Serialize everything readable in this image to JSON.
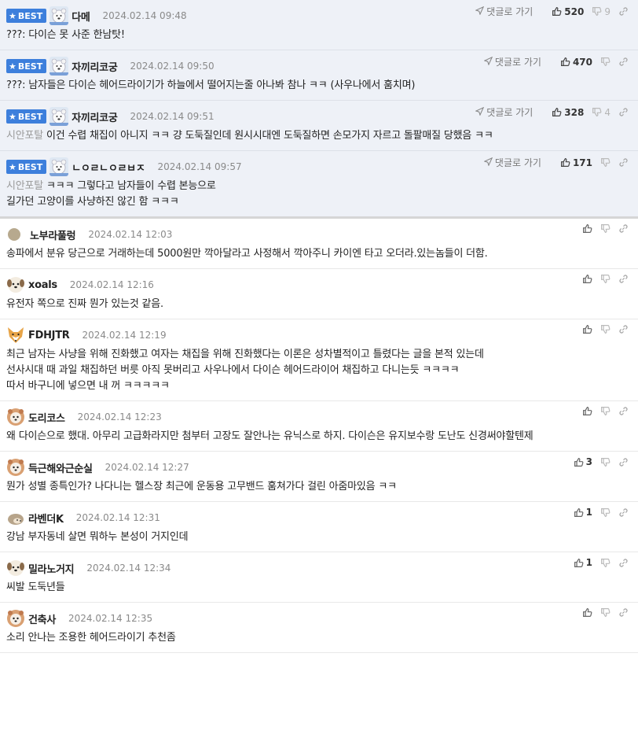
{
  "labels": {
    "best": "BEST",
    "goto_comment": "댓글로 가기"
  },
  "comments": [
    {
      "best": true,
      "avatar": "polar-bear",
      "nick": "다메",
      "date": "2024.02.14 09:48",
      "tag": "",
      "lines": [
        "???: 다이슨 못 사준 한남탓!"
      ],
      "up": "520",
      "down": "9",
      "goto": true
    },
    {
      "best": true,
      "avatar": "polar-bear",
      "nick": "자끼리코궁",
      "date": "2024.02.14 09:50",
      "tag": "",
      "lines": [
        "???: 남자들은 다이슨 헤어드라이기가 하늘에서 떨어지는줄 아나봐 참나 ㅋㅋ (사우나에서 훔치며)"
      ],
      "up": "470",
      "down": "",
      "goto": true
    },
    {
      "best": true,
      "avatar": "polar-bear",
      "nick": "자끼리코궁",
      "date": "2024.02.14 09:51",
      "tag": "시안포탈",
      "lines": [
        "이건 수렵 채집이 아니지 ㅋㅋ 걍 도둑질인데 원시시대엔 도둑질하면 손모가지 자르고 돌팔매질 당했음 ㅋㅋ"
      ],
      "up": "328",
      "down": "4",
      "goto": true
    },
    {
      "best": true,
      "avatar": "polar-bear",
      "nick": "ㄴㅇㄹㄴㅇㄹㅂㅈ",
      "date": "2024.02.14 09:57",
      "tag": "시안포탈",
      "lines": [
        "ㅋㅋㅋ 그렇다고 남자들이 수렵 본능으로",
        "길가던 고양이를 사냥하진 않긴 함 ㅋㅋㅋ"
      ],
      "up": "171",
      "down": "",
      "goto": true
    },
    {
      "best": false,
      "avatar": "dot",
      "nick": "노부라풀렁",
      "date": "2024.02.14 12:03",
      "tag": "",
      "lines": [
        "송파에서 분유 당근으로 거래하는데 5000원만 깍아달라고 사정해서 깍아주니 카이엔 타고 오더라.있는놈들이 더함."
      ],
      "up": "",
      "down": "",
      "goto": false
    },
    {
      "best": false,
      "avatar": "dog",
      "nick": "xoals",
      "date": "2024.02.14 12:16",
      "tag": "",
      "lines": [
        "유전자 쪽으로 진짜 뭔가 있는것 같음."
      ],
      "up": "",
      "down": "",
      "goto": false
    },
    {
      "best": false,
      "avatar": "fox",
      "nick": "FDHJTR",
      "date": "2024.02.14 12:19",
      "tag": "",
      "lines": [
        "최근 남자는 사냥을 위해 진화했고 여자는 채집을 위해 진화했다는 이론은 성차별적이고 틀렸다는 글을 본적 있는데",
        "선사시대 때 과일 채집하던 버릇 아직 못버리고 사우나에서 다이슨 헤어드라이어 채집하고 다니는듯 ㅋㅋㅋㅋ",
        "따서 바구니에 넣으면 내 꺼 ㅋㅋㅋㅋㅋ"
      ],
      "up": "",
      "down": "",
      "goto": false
    },
    {
      "best": false,
      "avatar": "poodle",
      "nick": "도리코스",
      "date": "2024.02.14 12:23",
      "tag": "",
      "lines": [
        "왜 다이슨으로 했대. 아무리 고급화라지만 첨부터 고장도 잘안나는 유닉스로 하지. 다이슨은 유지보수랑 도난도 신경써야할텐제"
      ],
      "up": "",
      "down": "",
      "goto": false
    },
    {
      "best": false,
      "avatar": "poodle",
      "nick": "득근해와근순실",
      "date": "2024.02.14 12:27",
      "tag": "",
      "lines": [
        "뭔가 성별 종특인가? 나다니는 헬스장 최근에 운동용 고무밴드 훔쳐가다 걸린 아줌마있음 ㅋㅋ"
      ],
      "up": "3",
      "down": "",
      "goto": false
    },
    {
      "best": false,
      "avatar": "hedgehog",
      "nick": "라벤더K",
      "date": "2024.02.14 12:31",
      "tag": "",
      "lines": [
        "강남 부자동네 살면 뭐하누 본성이 거지인데"
      ],
      "up": "1",
      "down": "",
      "goto": false
    },
    {
      "best": false,
      "avatar": "dog",
      "nick": "밀라노거지",
      "date": "2024.02.14 12:34",
      "tag": "",
      "lines": [
        "씨발 도둑년들"
      ],
      "up": "1",
      "down": "",
      "goto": false
    },
    {
      "best": false,
      "avatar": "poodle",
      "nick": "건축사",
      "date": "2024.02.14 12:35",
      "tag": "",
      "lines": [
        "소리 안나는 조용한 헤어드라이기 추천좀"
      ],
      "up": "",
      "down": "",
      "goto": false
    }
  ]
}
